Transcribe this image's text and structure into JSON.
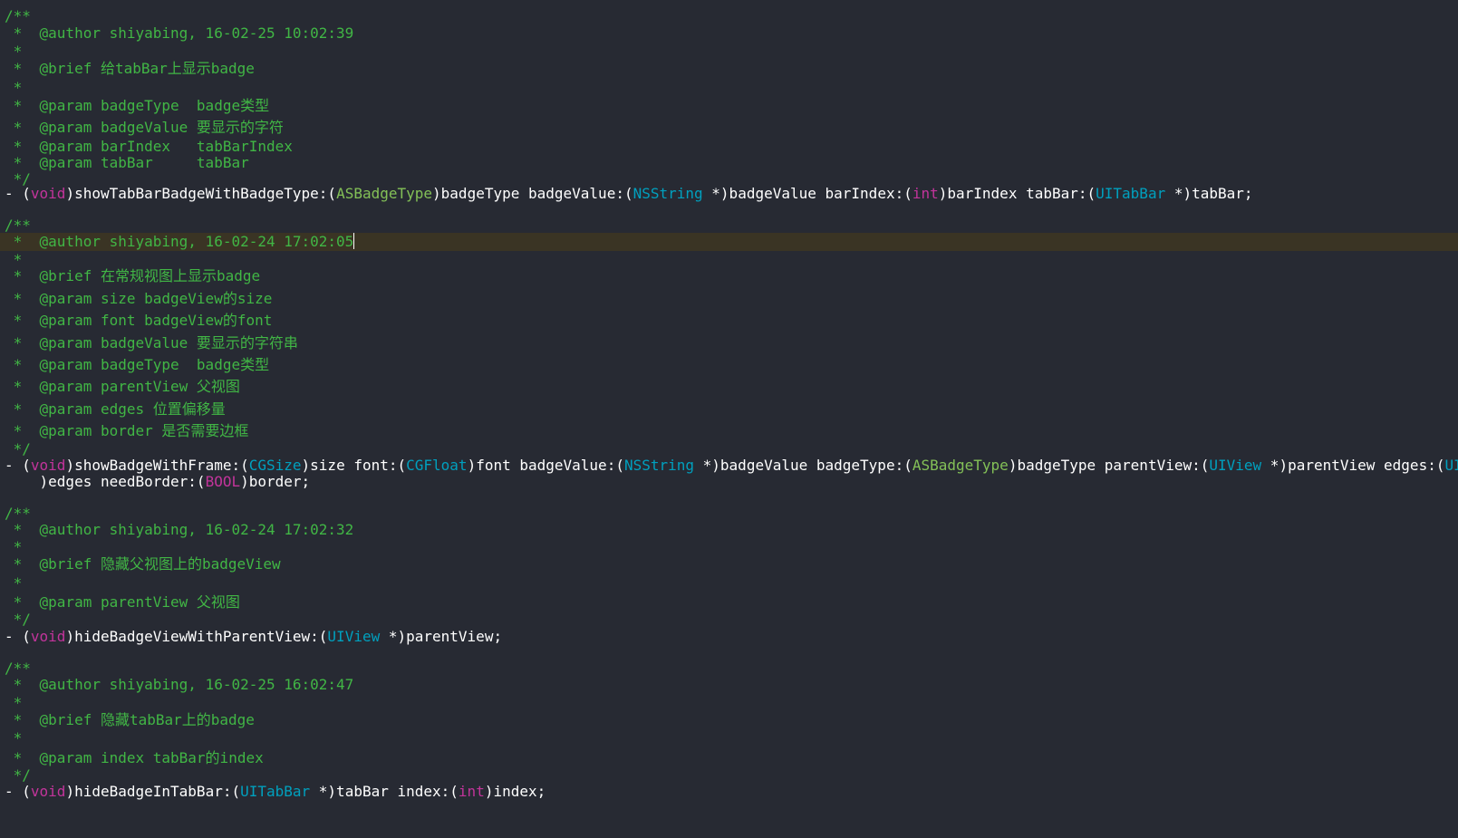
{
  "editor": {
    "colors": {
      "background": "#272a33",
      "current_line": "#3a3424",
      "comment": "#41b645",
      "plain": "#ffffff",
      "keyword": "#c2349b",
      "type": "#00a0be",
      "custom_type": "#83c057"
    },
    "lines": [
      [
        {
          "t": "/**",
          "k": "comment"
        }
      ],
      [
        {
          "t": " *  @author shiyabing, 16-02-25 10:02:39",
          "k": "comment"
        }
      ],
      [
        {
          "t": " *",
          "k": "comment"
        }
      ],
      [
        {
          "t": " *  @brief 给tabBar上显示badge",
          "k": "comment"
        }
      ],
      [
        {
          "t": " *",
          "k": "comment"
        }
      ],
      [
        {
          "t": " *  @param badgeType  badge类型",
          "k": "comment"
        }
      ],
      [
        {
          "t": " *  @param badgeValue 要显示的字符",
          "k": "comment"
        }
      ],
      [
        {
          "t": " *  @param barIndex   tabBarIndex",
          "k": "comment"
        }
      ],
      [
        {
          "t": " *  @param tabBar     tabBar",
          "k": "comment"
        }
      ],
      [
        {
          "t": " */",
          "k": "comment"
        }
      ],
      [
        {
          "t": "- (",
          "k": "plain"
        },
        {
          "t": "void",
          "k": "keyword"
        },
        {
          "t": ")showTabBarBadgeWithBadgeType:(",
          "k": "plain"
        },
        {
          "t": "ASBadgeType",
          "k": "custom_type"
        },
        {
          "t": ")badgeType badgeValue:(",
          "k": "plain"
        },
        {
          "t": "NSString",
          "k": "type"
        },
        {
          "t": " *)badgeValue barIndex:(",
          "k": "plain"
        },
        {
          "t": "int",
          "k": "keyword"
        },
        {
          "t": ")barIndex tabBar:(",
          "k": "plain"
        },
        {
          "t": "UITabBar",
          "k": "type"
        },
        {
          "t": " *)tabBar;",
          "k": "plain"
        }
      ],
      [],
      [
        {
          "t": "/**",
          "k": "comment"
        }
      ],
      [
        {
          "t": " *  @author shiyabing, 16-02-24 17:02:05",
          "k": "comment"
        }
      ],
      [
        {
          "t": " *",
          "k": "comment"
        }
      ],
      [
        {
          "t": " *  @brief 在常规视图上显示badge",
          "k": "comment"
        }
      ],
      [
        {
          "t": " *  @param size badgeView的size",
          "k": "comment"
        }
      ],
      [
        {
          "t": " *  @param font badgeView的font",
          "k": "comment"
        }
      ],
      [
        {
          "t": " *  @param badgeValue 要显示的字符串",
          "k": "comment"
        }
      ],
      [
        {
          "t": " *  @param badgeType  badge类型",
          "k": "comment"
        }
      ],
      [
        {
          "t": " *  @param parentView 父视图",
          "k": "comment"
        }
      ],
      [
        {
          "t": " *  @param edges 位置偏移量",
          "k": "comment"
        }
      ],
      [
        {
          "t": " *  @param border 是否需要边框",
          "k": "comment"
        }
      ],
      [
        {
          "t": " */",
          "k": "comment"
        }
      ],
      [
        {
          "t": "- (",
          "k": "plain"
        },
        {
          "t": "void",
          "k": "keyword"
        },
        {
          "t": ")showBadgeWithFrame:(",
          "k": "plain"
        },
        {
          "t": "CGSize",
          "k": "type"
        },
        {
          "t": ")size font:(",
          "k": "plain"
        },
        {
          "t": "CGFloat",
          "k": "type"
        },
        {
          "t": ")font badgeValue:(",
          "k": "plain"
        },
        {
          "t": "NSString",
          "k": "type"
        },
        {
          "t": " *)badgeValue badgeType:(",
          "k": "plain"
        },
        {
          "t": "ASBadgeType",
          "k": "custom_type"
        },
        {
          "t": ")badgeType parentView:(",
          "k": "plain"
        },
        {
          "t": "UIView",
          "k": "type"
        },
        {
          "t": " *)parentView edges:(",
          "k": "plain"
        },
        {
          "t": "UIEdgeInsets",
          "k": "type"
        }
      ],
      [
        {
          "t": "    )edges needBorder:(",
          "k": "plain"
        },
        {
          "t": "BOOL",
          "k": "keyword"
        },
        {
          "t": ")border;",
          "k": "plain"
        }
      ],
      [],
      [
        {
          "t": "/**",
          "k": "comment"
        }
      ],
      [
        {
          "t": " *  @author shiyabing, 16-02-24 17:02:32",
          "k": "comment"
        }
      ],
      [
        {
          "t": " *",
          "k": "comment"
        }
      ],
      [
        {
          "t": " *  @brief 隐藏父视图上的badgeView",
          "k": "comment"
        }
      ],
      [
        {
          "t": " *",
          "k": "comment"
        }
      ],
      [
        {
          "t": " *  @param parentView 父视图",
          "k": "comment"
        }
      ],
      [
        {
          "t": " */",
          "k": "comment"
        }
      ],
      [
        {
          "t": "- (",
          "k": "plain"
        },
        {
          "t": "void",
          "k": "keyword"
        },
        {
          "t": ")hideBadgeViewWithParentView:(",
          "k": "plain"
        },
        {
          "t": "UIView",
          "k": "type"
        },
        {
          "t": " *)parentView;",
          "k": "plain"
        }
      ],
      [],
      [
        {
          "t": "/**",
          "k": "comment"
        }
      ],
      [
        {
          "t": " *  @author shiyabing, 16-02-25 16:02:47",
          "k": "comment"
        }
      ],
      [
        {
          "t": " *",
          "k": "comment"
        }
      ],
      [
        {
          "t": " *  @brief 隐藏tabBar上的badge",
          "k": "comment"
        }
      ],
      [
        {
          "t": " *",
          "k": "comment"
        }
      ],
      [
        {
          "t": " *  @param index tabBar的index",
          "k": "comment"
        }
      ],
      [
        {
          "t": " */",
          "k": "comment"
        }
      ],
      [
        {
          "t": "- (",
          "k": "plain"
        },
        {
          "t": "void",
          "k": "keyword"
        },
        {
          "t": ")hideBadgeInTabBar:(",
          "k": "plain"
        },
        {
          "t": "UITabBar",
          "k": "type"
        },
        {
          "t": " *)tabBar index:(",
          "k": "plain"
        },
        {
          "t": "int",
          "k": "keyword"
        },
        {
          "t": ")index;",
          "k": "plain"
        }
      ]
    ],
    "current_line_index": 13,
    "caret_after_token": 0
  }
}
